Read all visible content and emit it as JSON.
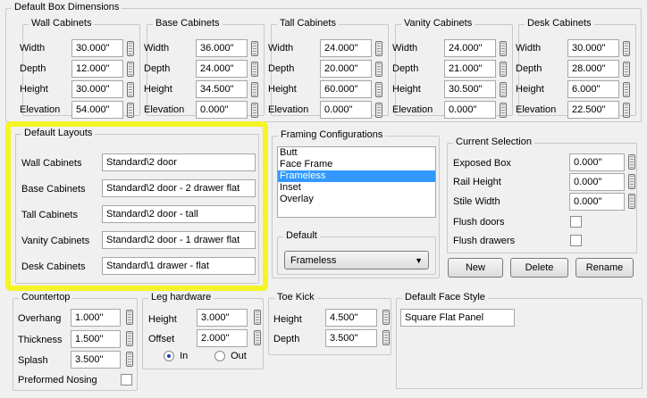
{
  "box_dimensions": {
    "title": "Default Box Dimensions",
    "groups": [
      {
        "title": "Wall Cabinets",
        "rows": [
          {
            "label": "Width",
            "value": "30.000\""
          },
          {
            "label": "Depth",
            "value": "12.000\""
          },
          {
            "label": "Height",
            "value": "30.000\""
          },
          {
            "label": "Elevation",
            "value": "54.000\""
          }
        ]
      },
      {
        "title": "Base Cabinets",
        "rows": [
          {
            "label": "Width",
            "value": "36.000\""
          },
          {
            "label": "Depth",
            "value": "24.000\""
          },
          {
            "label": "Height",
            "value": "34.500\""
          },
          {
            "label": "Elevation",
            "value": "0.000\""
          }
        ]
      },
      {
        "title": "Tall Cabinets",
        "rows": [
          {
            "label": "Width",
            "value": "24.000\""
          },
          {
            "label": "Depth",
            "value": "20.000\""
          },
          {
            "label": "Height",
            "value": "60.000\""
          },
          {
            "label": "Elevation",
            "value": "0.000\""
          }
        ]
      },
      {
        "title": "Vanity Cabinets",
        "rows": [
          {
            "label": "Width",
            "value": "24.000\""
          },
          {
            "label": "Depth",
            "value": "21.000\""
          },
          {
            "label": "Height",
            "value": "30.500\""
          },
          {
            "label": "Elevation",
            "value": "0.000\""
          }
        ]
      },
      {
        "title": "Desk Cabinets",
        "rows": [
          {
            "label": "Width",
            "value": "30.000\""
          },
          {
            "label": "Depth",
            "value": "28.000\""
          },
          {
            "label": "Height",
            "value": "6.000\""
          },
          {
            "label": "Elevation",
            "value": "22.500\""
          }
        ]
      }
    ]
  },
  "default_layouts": {
    "title": "Default Layouts",
    "rows": [
      {
        "label": "Wall Cabinets",
        "value": "Standard\\2 door"
      },
      {
        "label": "Base Cabinets",
        "value": "Standard\\2 door - 2 drawer flat"
      },
      {
        "label": "Tall Cabinets",
        "value": "Standard\\2 door - tall"
      },
      {
        "label": "Vanity Cabinets",
        "value": "Standard\\2 door - 1 drawer flat"
      },
      {
        "label": "Desk Cabinets",
        "value": "Standard\\1 drawer - flat"
      }
    ],
    "highlight_color": "#f5f525"
  },
  "framing": {
    "title": "Framing Configurations",
    "items": [
      "Butt",
      "Face Frame",
      "Frameless",
      "Inset",
      "Overlay"
    ],
    "selected": "Frameless",
    "default_label": "Default",
    "default_value": "Frameless"
  },
  "current_selection": {
    "title": "Current Selection",
    "exposed_box_label": "Exposed Box",
    "exposed_box_value": "0.000\"",
    "rail_height_label": "Rail Height",
    "rail_height_value": "0.000\"",
    "stile_width_label": "Stile Width",
    "stile_width_value": "0.000\"",
    "flush_doors_label": "Flush doors",
    "flush_drawers_label": "Flush drawers",
    "new_label": "New",
    "delete_label": "Delete",
    "rename_label": "Rename"
  },
  "countertop": {
    "title": "Countertop",
    "overhang_label": "Overhang",
    "overhang_value": "1.000\"",
    "thickness_label": "Thickness",
    "thickness_value": "1.500\"",
    "splash_label": "Splash",
    "splash_value": "3.500\"",
    "preformed_label": "Preformed Nosing"
  },
  "leg_hardware": {
    "title": "Leg hardware",
    "height_label": "Height",
    "height_value": "3.000\"",
    "offset_label": "Offset",
    "offset_value": "2.000\"",
    "in_label": "In",
    "out_label": "Out"
  },
  "toe_kick": {
    "title": "Toe Kick",
    "height_label": "Height",
    "height_value": "4.500\"",
    "depth_label": "Depth",
    "depth_value": "3.500\""
  },
  "face_style": {
    "title": "Default Face Style",
    "value": "Square Flat Panel"
  }
}
